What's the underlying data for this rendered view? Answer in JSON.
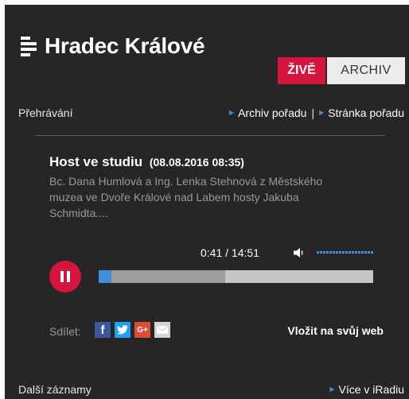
{
  "header": {
    "station_name": "Hradec Králové",
    "live_label": "ŽIVĚ",
    "archive_label": "ARCHIV"
  },
  "nav": {
    "section_label": "Přehrávání",
    "archive_link": "Archiv pořadu",
    "separator": "|",
    "show_page_link": "Stránka pořadu"
  },
  "episode": {
    "title": "Host ve studiu",
    "datetime": "(08.08.2016 08:35)",
    "description": "Bc. Dana Humlová a Ing. Lenka Stehnová z Městského muzea ve Dvoře Králové nad Labem hosty Jakuba Schmidta...."
  },
  "player": {
    "time_display": "0:41 / 14:51",
    "progress_played_fraction": 0.047,
    "progress_buffered_fraction": 0.46,
    "state_icon": "pause-icon",
    "volume_icon": "speaker-icon"
  },
  "share": {
    "label": "Sdílet:",
    "networks": [
      "facebook-icon",
      "twitter-icon",
      "google-plus-icon",
      "email-icon"
    ]
  },
  "embed_label": "Vložit na svůj web",
  "footer": {
    "more_records_label": "Další záznamy",
    "more_link": "Více v iRadiu"
  },
  "colors": {
    "background": "#272525",
    "accent_red": "#d6153e",
    "accent_blue": "#3f8ed8"
  }
}
